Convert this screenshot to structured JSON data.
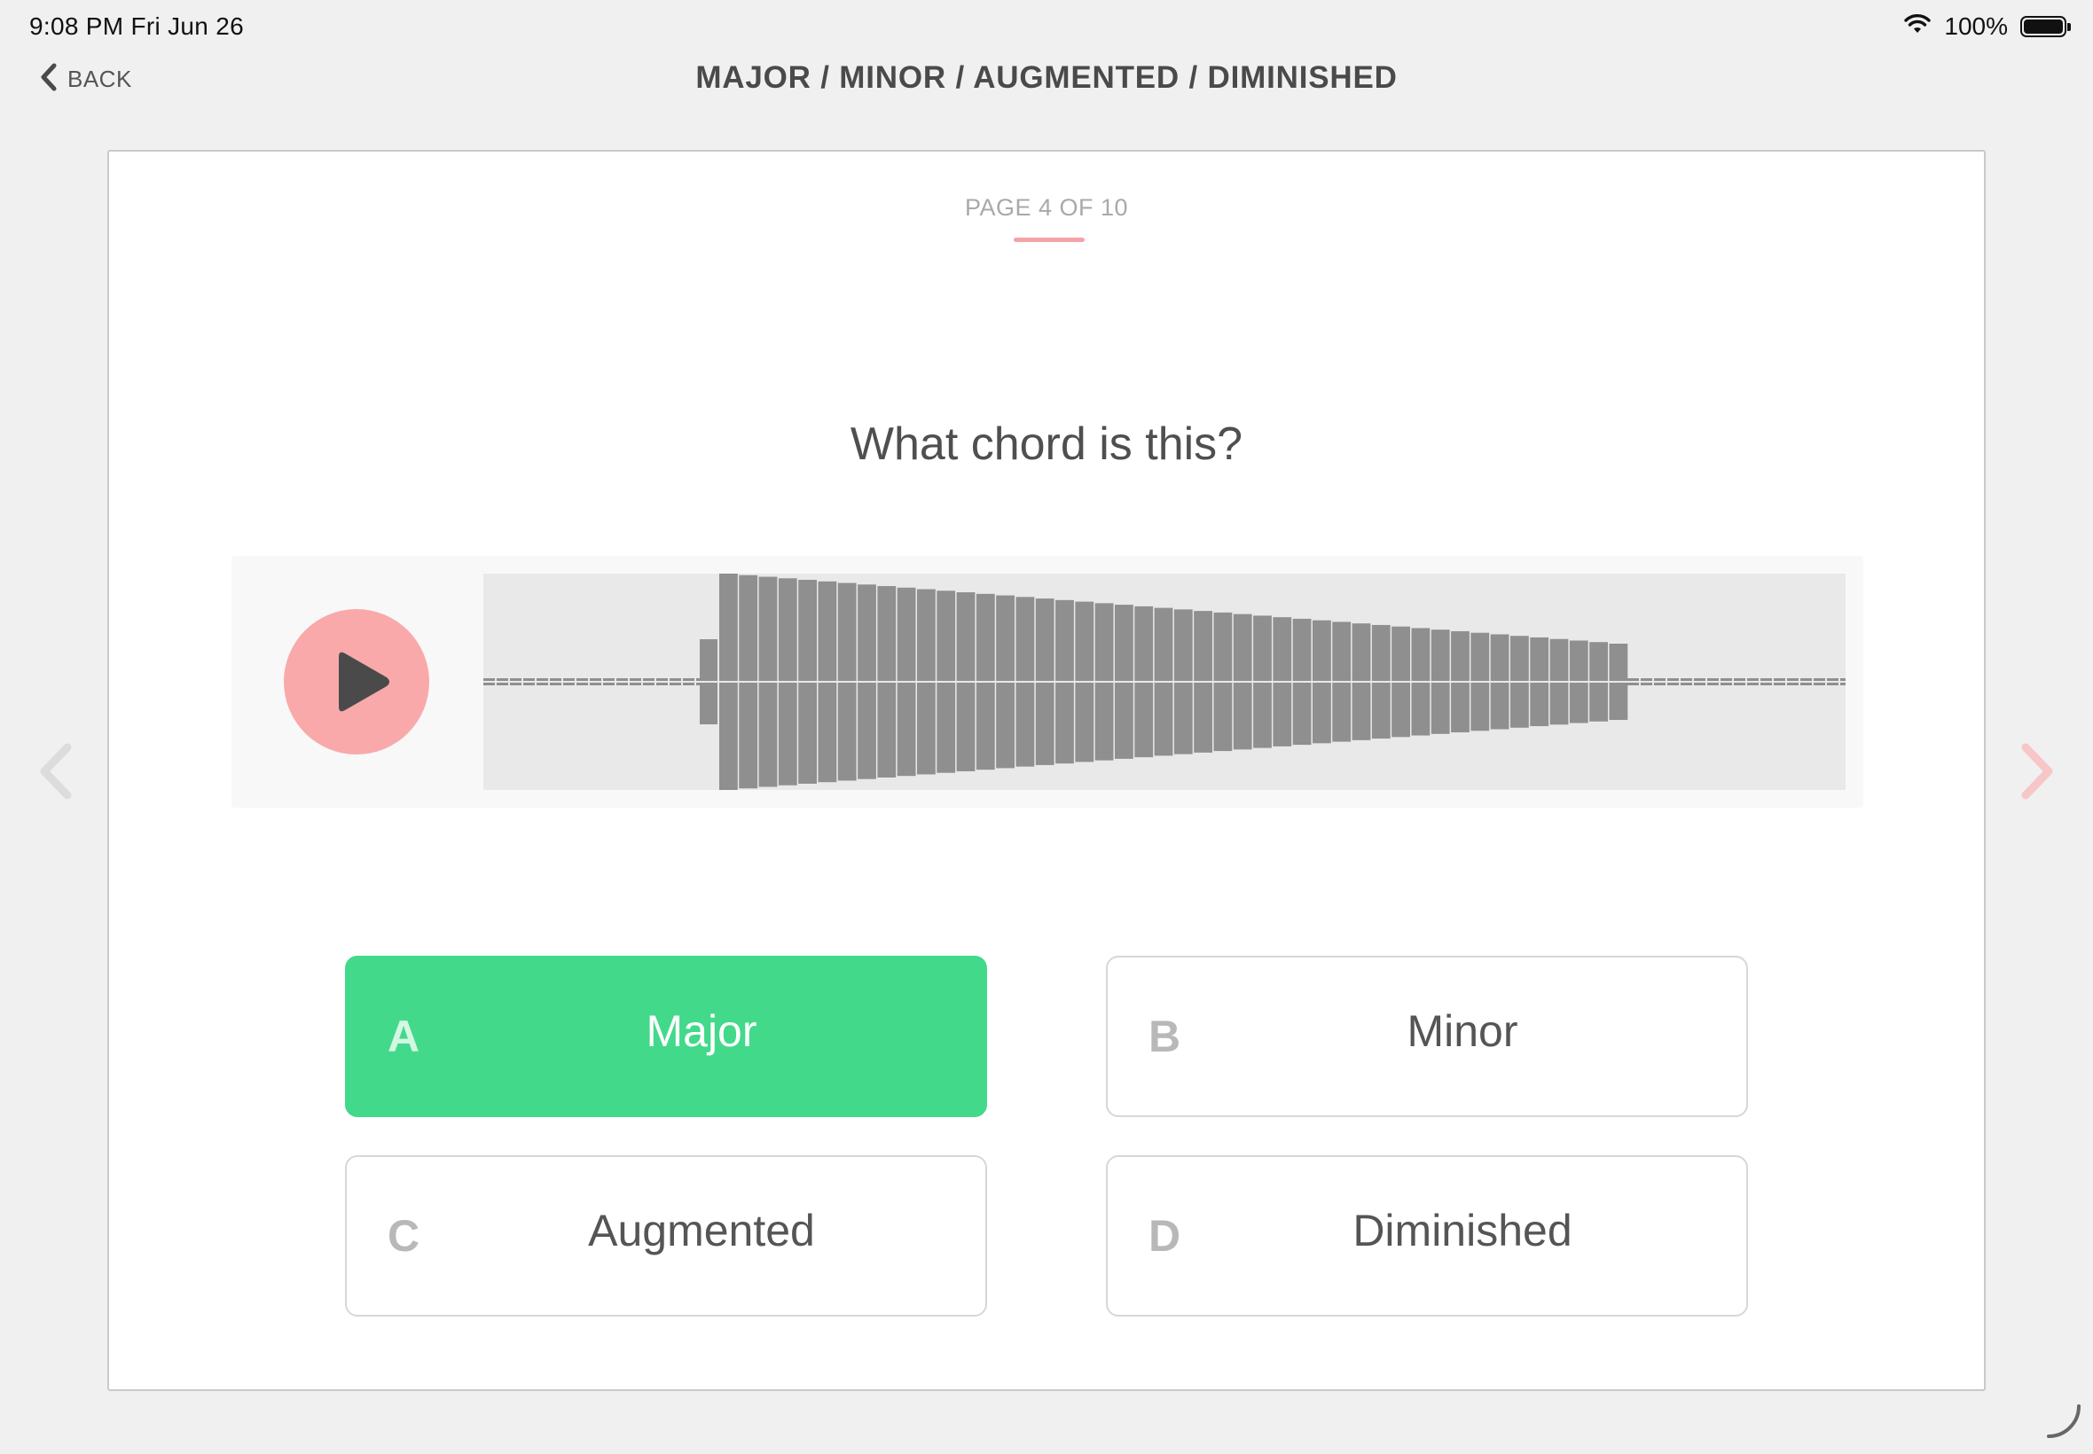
{
  "status_bar": {
    "time": "9:08 PM   Fri Jun 26",
    "battery": "100%",
    "battery_level": 1.0
  },
  "nav": {
    "back_label": "BACK",
    "title": "MAJOR / MINOR / AUGMENTED / DIMINISHED"
  },
  "quiz": {
    "page_indicator": "PAGE 4 OF 10",
    "question": "What chord is this?",
    "answers": [
      {
        "letter": "A",
        "label": "Major",
        "selected": true
      },
      {
        "letter": "B",
        "label": "Minor",
        "selected": false
      },
      {
        "letter": "C",
        "label": "Augmented",
        "selected": false
      },
      {
        "letter": "D",
        "label": "Diminished",
        "selected": false
      }
    ]
  },
  "colors": {
    "accent_pink": "#f9a9aa",
    "selected_green": "#42d98a",
    "waveform_bar": "#8f8f8f"
  },
  "icons": {
    "back": "chevron-left-icon",
    "play": "play-icon",
    "prev": "chevron-left-icon",
    "next": "chevron-right-icon",
    "wifi": "wifi-icon",
    "battery": "battery-icon"
  }
}
